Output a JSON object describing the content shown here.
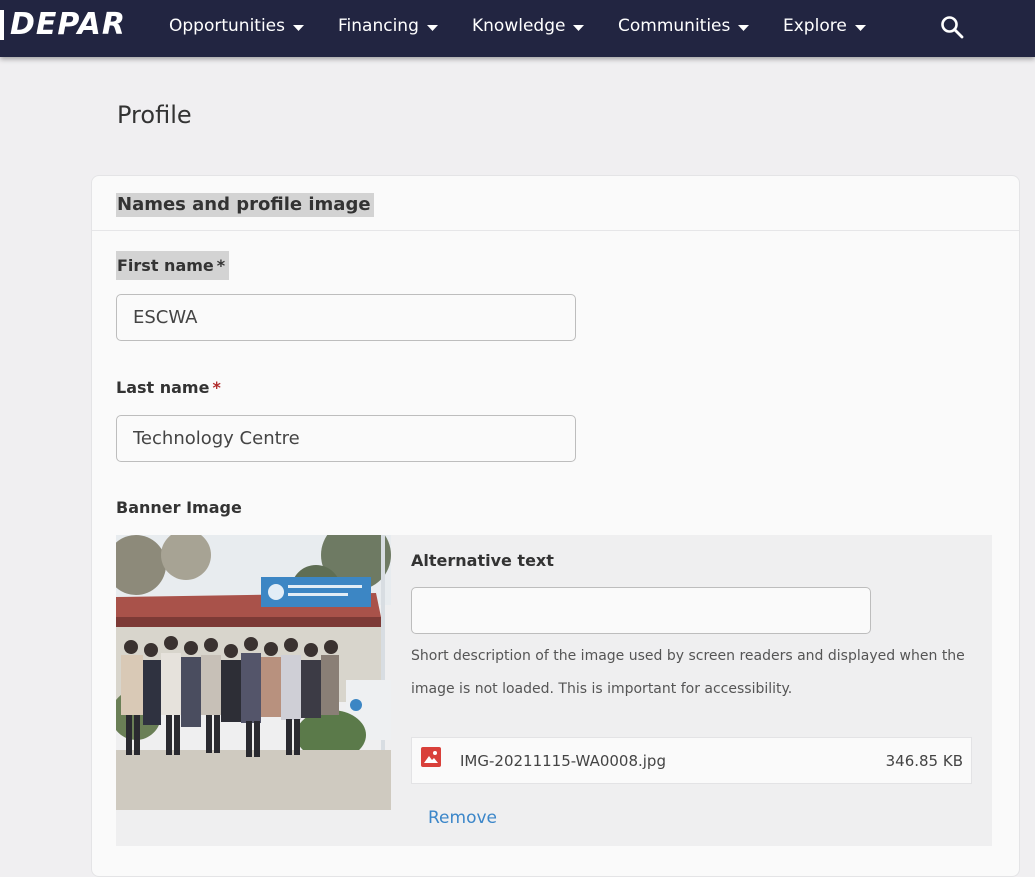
{
  "nav": {
    "logo": "DEPAR",
    "items": [
      {
        "label": "Opportunities"
      },
      {
        "label": "Financing"
      },
      {
        "label": "Knowledge"
      },
      {
        "label": "Communities"
      },
      {
        "label": "Explore"
      }
    ],
    "search_icon": "search-icon"
  },
  "page": {
    "title": "Profile"
  },
  "section": {
    "title": "Names and profile image"
  },
  "first_name": {
    "label": "First name",
    "required_mark": "*",
    "value": "ESCWA"
  },
  "last_name": {
    "label": "Last name",
    "required_mark": "*",
    "value": "Technology Centre"
  },
  "banner": {
    "label": "Banner Image",
    "alt_label": "Alternative text",
    "alt_value": "",
    "help_text": "Short description of the image used by screen readers and displayed when the image is not loaded. This is important for accessibility.",
    "file_name": "IMG-20211115-WA0008.jpg",
    "file_size": "346.85 KB",
    "file_icon": "image-file-icon",
    "remove_label": "Remove"
  },
  "colors": {
    "nav_bg": "#222541",
    "page_bg": "#f0eff1",
    "link": "#3b86c9",
    "required": "#b02a2a",
    "file_icon": "#d9403a"
  }
}
